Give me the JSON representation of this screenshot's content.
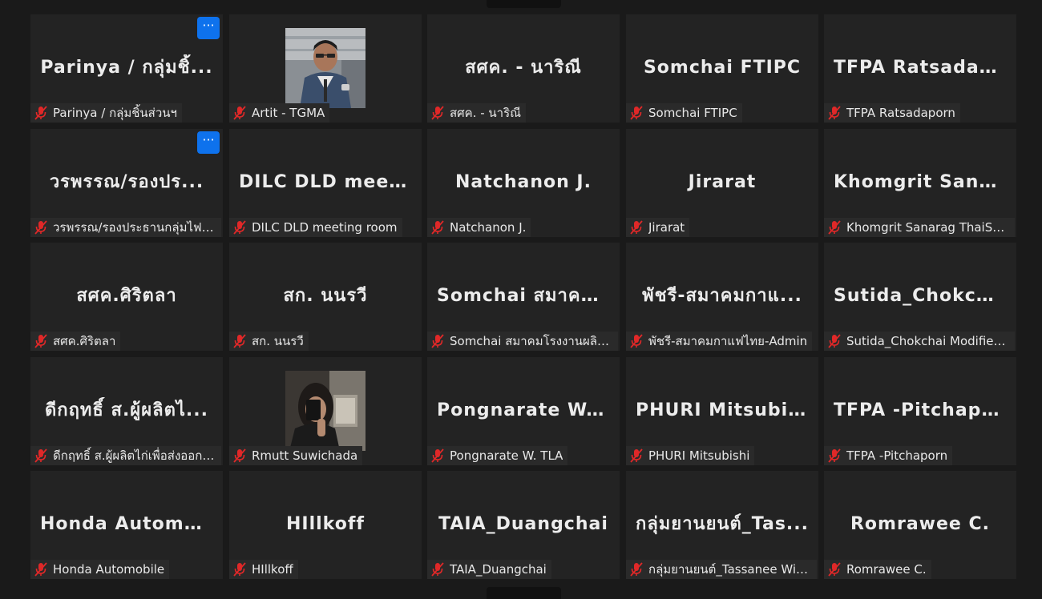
{
  "meeting": {
    "more_label": "···",
    "tiles": [
      {
        "display": "Parinya / กลุ่มชิ้...",
        "label": "Parinya / กลุ่มชิ้นส่วนฯ",
        "more": true
      },
      {
        "display": "",
        "label": "Artit - TGMA",
        "photo": "photo-man"
      },
      {
        "display": "สศค. - นาริณี",
        "label": "สศค. - นาริณี"
      },
      {
        "display": "Somchai FTIPC",
        "label": "Somchai FTIPC"
      },
      {
        "display": "TFPA Ratsadapo...",
        "label": "TFPA Ratsadaporn"
      },
      {
        "display": "วรพรรณ/รองปร...",
        "label": "วรพรรณ/รองประธานกลุ่มไฟฟ้าฯ",
        "more": true
      },
      {
        "display": "DILC DLD meeti...",
        "label": "DILC DLD meeting room"
      },
      {
        "display": "Natchanon J.",
        "label": "Natchanon J."
      },
      {
        "display": "Jirarat",
        "label": "Jirarat"
      },
      {
        "display": "Khomgrit Sanar...",
        "label": "Khomgrit Sanarag ThaiShri..."
      },
      {
        "display": "สศค.ศิริตลา",
        "label": "สศค.ศิริตลา"
      },
      {
        "display": "สก. นนรวี",
        "label": "สก. นนรวี"
      },
      {
        "display": "Somchai สมาคม...",
        "label": "Somchai สมาคมโรงงานผลิตภั..."
      },
      {
        "display": "พัชรี-สมาคมกาแ...",
        "label": "พัชรี-สมาคมกาแฟไทย-Admin"
      },
      {
        "display": "Sutida_Chokcha...",
        "label": "Sutida_Chokchai Modified St..."
      },
      {
        "display": "ดีกฤทธิ์ ส.ผู้ผลิตไ...",
        "label": "ดีกฤทธิ์ ส.ผู้ผลิตไก่เพื่อส่งออกไทย"
      },
      {
        "display": "",
        "label": "Rmutt Suwichada",
        "photo": "photo-woman"
      },
      {
        "display": "Pongnarate W....",
        "label": "Pongnarate W. TLA"
      },
      {
        "display": "PHURI Mitsubishi",
        "label": "PHURI Mitsubishi"
      },
      {
        "display": "TFPA -Pitchaporn",
        "label": "TFPA -Pitchaporn"
      },
      {
        "display": "Honda Automo...",
        "label": "Honda Automobile"
      },
      {
        "display": "HIllkoff",
        "label": "HIllkoff"
      },
      {
        "display": "TAIA_Duangchai",
        "label": "TAIA_Duangchai"
      },
      {
        "display": "กลุ่มยานยนต์_Tas...",
        "label": "กลุ่มยานยนต์_Tassanee Wiwat..."
      },
      {
        "display": "Romrawee C.",
        "label": "Romrawee C."
      }
    ]
  },
  "colors": {
    "background": "#1a1a1a",
    "tile": "#232323",
    "mute_red": "#e02828",
    "more_button": "#0e72ed"
  }
}
